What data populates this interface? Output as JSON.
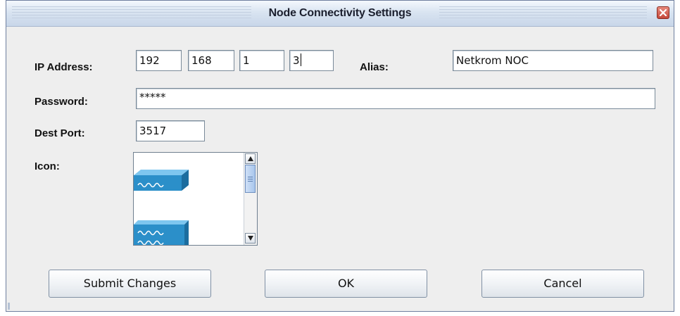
{
  "window": {
    "title": "Node Connectivity Settings",
    "close_icon": "close-icon"
  },
  "ip": {
    "label": "IP Address:",
    "octets": [
      "192",
      "168",
      "1",
      "3"
    ]
  },
  "alias": {
    "label": "Alias:",
    "value": "Netkrom NOC"
  },
  "password": {
    "label": "Password:",
    "value": "*****"
  },
  "dest_port": {
    "label": "Dest Port:",
    "value": "3517"
  },
  "icon": {
    "label": "Icon:",
    "items": [
      "network-switch-icon",
      "network-switch-icon"
    ]
  },
  "buttons": {
    "submit": "Submit Changes",
    "ok": "OK",
    "cancel": "Cancel"
  },
  "colors": {
    "titlebar": "#d9e4f1",
    "close_button": "#c4483a",
    "switch_icon": "#2b8fc9"
  }
}
